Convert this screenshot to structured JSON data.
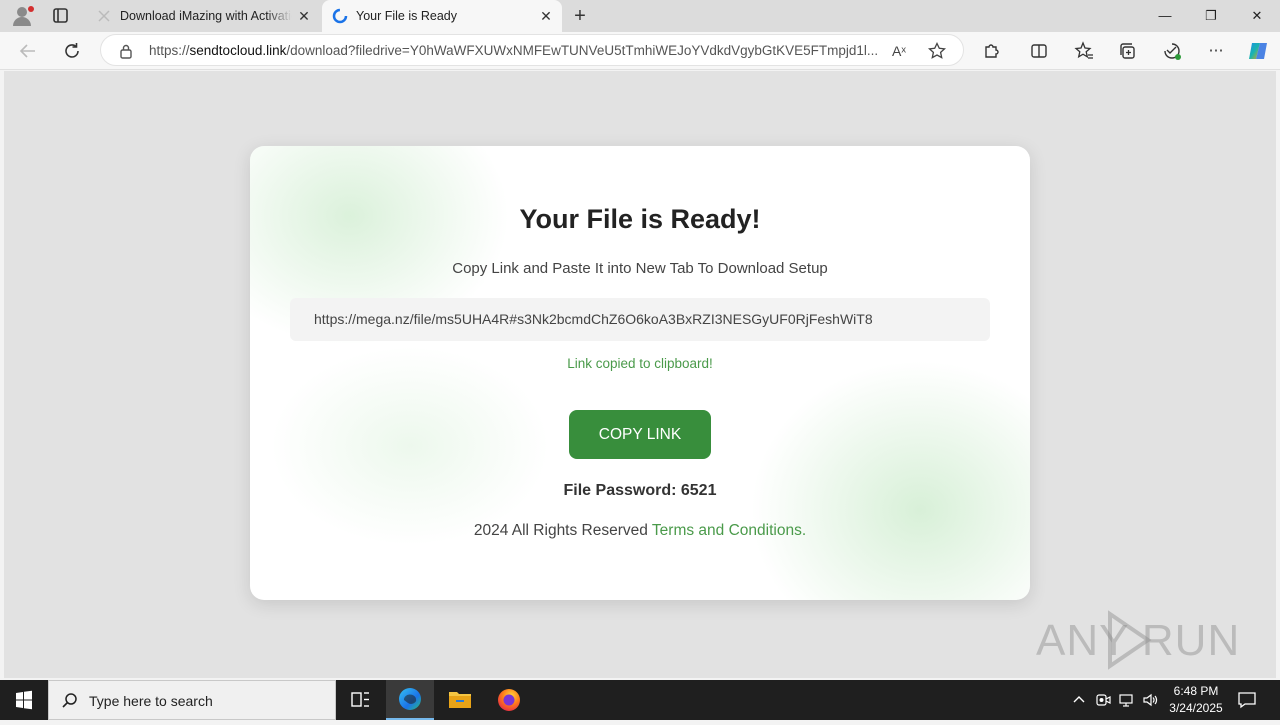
{
  "browser": {
    "tabs": [
      {
        "title": "Download iMazing with Activatic",
        "active": false
      },
      {
        "title": "Your File is Ready",
        "active": true
      }
    ],
    "address_prefix": "https://",
    "address_domain": "sendtocloud.link",
    "address_path": "/download?filedrive=Y0hWaWFXUWxNMFEwTUNVeU5tTmhiWEJoYVdkdVgybGtKVE5FTmpjd1l...",
    "window_controls": {
      "minimize": "—",
      "restore": "❐",
      "close": "✕"
    },
    "new_tab": "+"
  },
  "page": {
    "heading": "Your File is Ready!",
    "subheading": "Copy Link and Paste It into New Tab To Download Setup",
    "link": "https://mega.nz/file/ms5UHA4R#s3Nk2bcmdChZ6O6koA3BxRZI3NESGyUF0RjFeshWiT8",
    "copied_message": "Link copied to clipboard!",
    "copy_button": "COPY LINK",
    "password_text": "File Password: 6521",
    "footer_text": "2024 All Rights Reserved ",
    "terms_link": "Terms and Conditions."
  },
  "watermark": "ANY RUN",
  "taskbar": {
    "search_placeholder": "Type here to search",
    "time": "6:48 PM",
    "date": "3/24/2025"
  },
  "colors": {
    "accent_green": "#388e3c",
    "link_green": "#4a9a4a",
    "edge_blue": "#1a73e8"
  },
  "icons": [
    "profile-icon",
    "tab-actions-icon",
    "back-icon",
    "refresh-icon",
    "lock-icon",
    "read-aloud-icon",
    "favorite-star-icon",
    "extensions-icon",
    "split-screen-icon",
    "favorites-icon",
    "collections-icon",
    "browser-essentials-icon",
    "more-icon",
    "copilot-icon",
    "windows-icon",
    "search-icon",
    "task-view-icon",
    "edge-icon",
    "file-explorer-icon",
    "firefox-icon",
    "chevron-up-icon",
    "meet-now-icon",
    "network-icon",
    "volume-icon",
    "notification-icon"
  ]
}
